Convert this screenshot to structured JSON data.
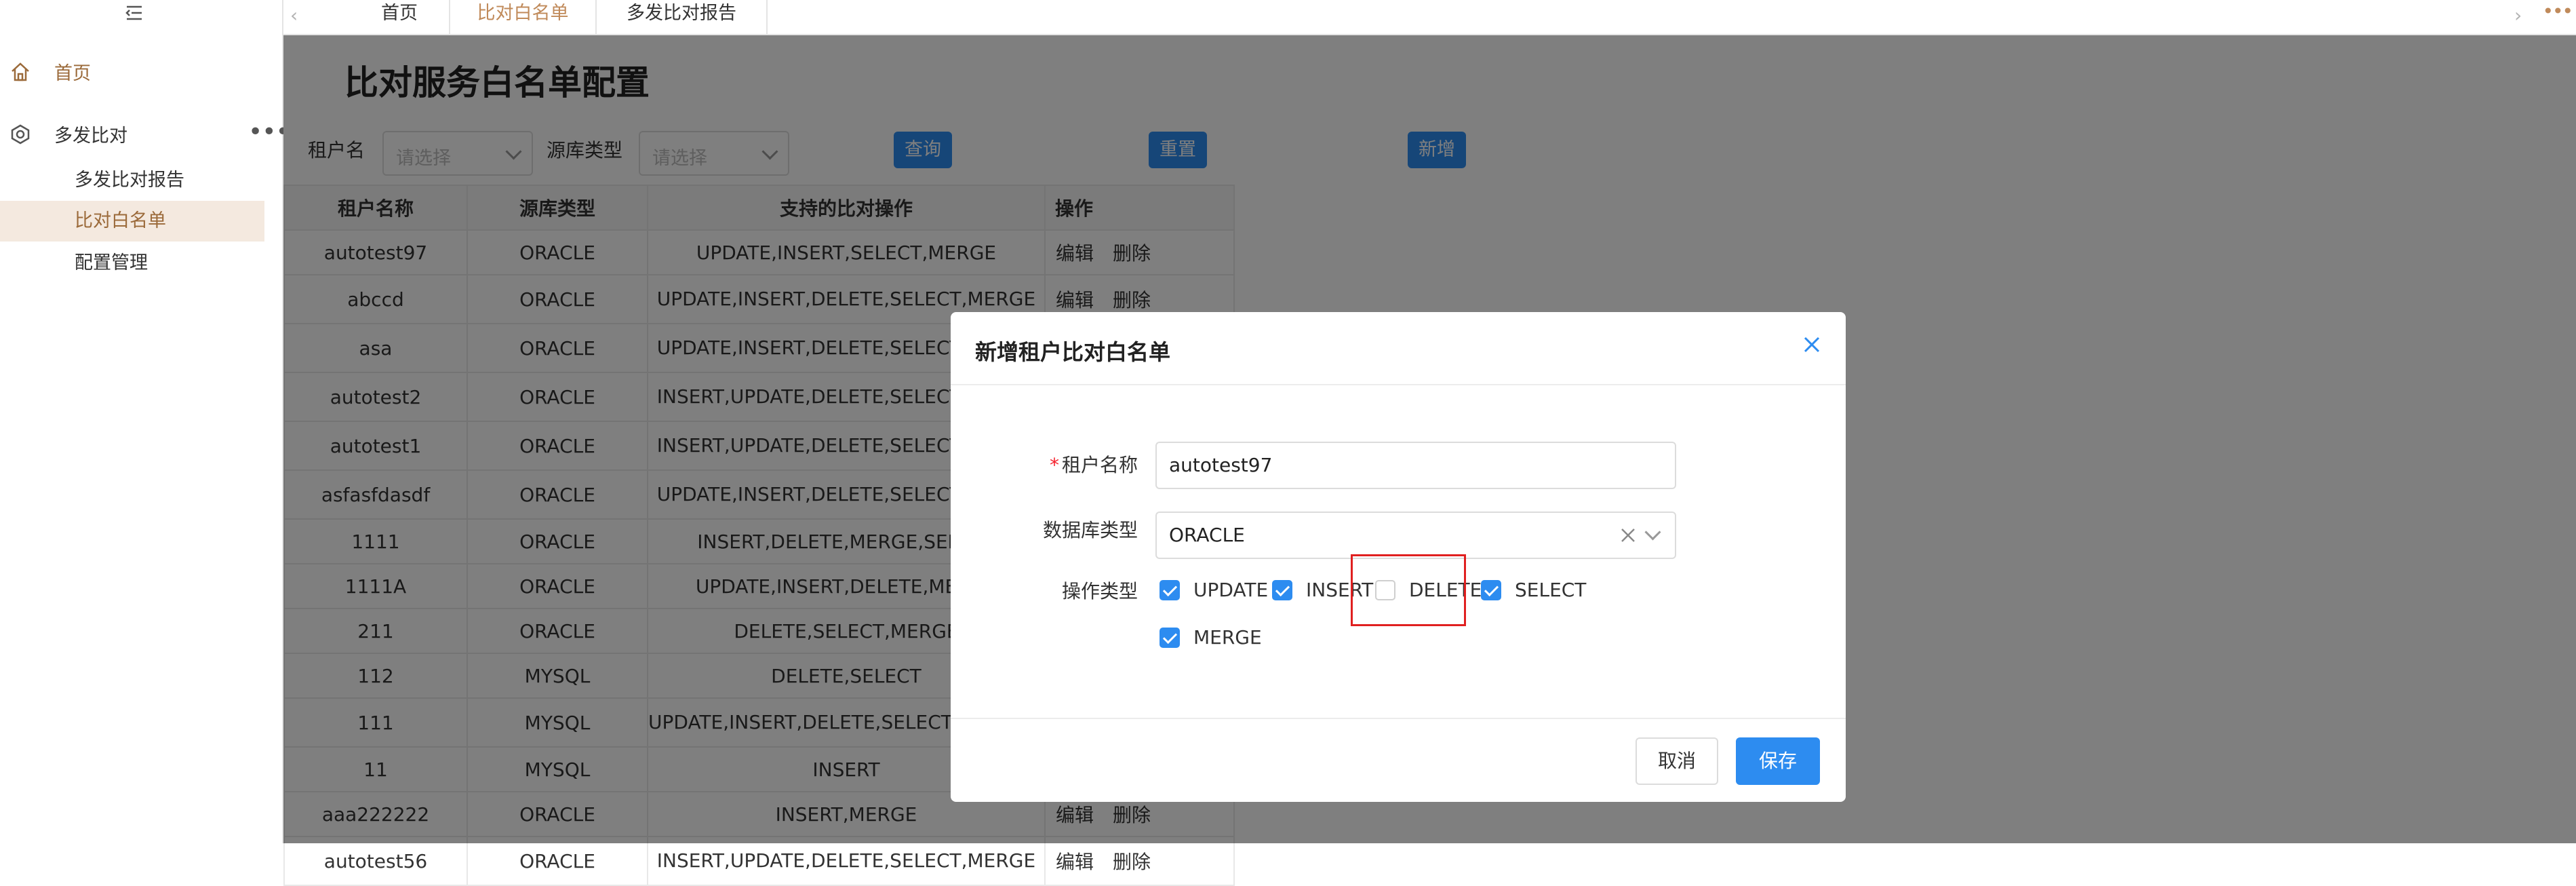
{
  "sidebar": {
    "home_label": "首页",
    "group_label": "多发比对",
    "sub_items": [
      {
        "label": "多发比对报告",
        "active": false
      },
      {
        "label": "比对白名单",
        "active": true
      },
      {
        "label": "配置管理",
        "active": false
      }
    ]
  },
  "tabs": [
    "首页",
    "比对白名单",
    "多发比对报告"
  ],
  "active_tab": 1,
  "page": {
    "title": "比对服务白名单配置",
    "filters": {
      "tenant_label": "租户名",
      "tenant_placeholder": "请选择",
      "source_label": "源库类型",
      "source_placeholder": "请选择"
    },
    "buttons": {
      "query": "查询",
      "reset": "重置",
      "add": "新增"
    },
    "table": {
      "headers": [
        "租户名称",
        "源库类型",
        "支持的比对操作",
        "操作"
      ],
      "action_edit": "编辑",
      "action_delete": "删除",
      "rows": [
        [
          "autotest97",
          "ORACLE",
          "UPDATE,INSERT,SELECT,MERGE"
        ],
        [
          "abccd",
          "ORACLE",
          "UPDATE,INSERT,DELETE,SELECT,MERGE"
        ],
        [
          "asa",
          "ORACLE",
          "UPDATE,INSERT,DELETE,SELECT,MERGE"
        ],
        [
          "autotest2",
          "ORACLE",
          "INSERT,UPDATE,DELETE,SELECT,MERGE"
        ],
        [
          "autotest1",
          "ORACLE",
          "INSERT,UPDATE,DELETE,SELECT,MERGE"
        ],
        [
          "asfasfdasdf",
          "ORACLE",
          "UPDATE,INSERT,DELETE,SELECT,MERGE"
        ],
        [
          "1111",
          "ORACLE",
          "INSERT,DELETE,MERGE,SELECT"
        ],
        [
          "1111A",
          "ORACLE",
          "UPDATE,INSERT,DELETE,MERGE"
        ],
        [
          "211",
          "ORACLE",
          "DELETE,SELECT,MERGE"
        ],
        [
          "112",
          "MYSQL",
          "DELETE,SELECT"
        ],
        [
          "111",
          "MYSQL",
          "UPDATE,INSERT,DELETE,SELECT,REPLACE"
        ],
        [
          "11",
          "MYSQL",
          "INSERT"
        ],
        [
          "aaa222222",
          "ORACLE",
          "INSERT,MERGE"
        ],
        [
          "autotest56",
          "ORACLE",
          "INSERT,UPDATE,DELETE,SELECT,MERGE"
        ]
      ]
    }
  },
  "dialog": {
    "title": "新增租户比对白名单",
    "tenant_label": "租户名称",
    "tenant_required_mark": "*",
    "tenant_value": "autotest97",
    "db_type_label": "数据库类型",
    "db_type_value": "ORACLE",
    "op_type_label": "操作类型",
    "options": [
      {
        "label": "UPDATE",
        "checked": true
      },
      {
        "label": "INSERT",
        "checked": true
      },
      {
        "label": "DELETE",
        "checked": false
      },
      {
        "label": "SELECT",
        "checked": true
      },
      {
        "label": "MERGE",
        "checked": true
      }
    ],
    "cancel_label": "取消",
    "save_label": "保存"
  },
  "colors": {
    "primary": "#2d8cf0",
    "brand_brown": "#9b6a3a",
    "active_bg": "#f4e9df",
    "highlight": "#e02020"
  }
}
